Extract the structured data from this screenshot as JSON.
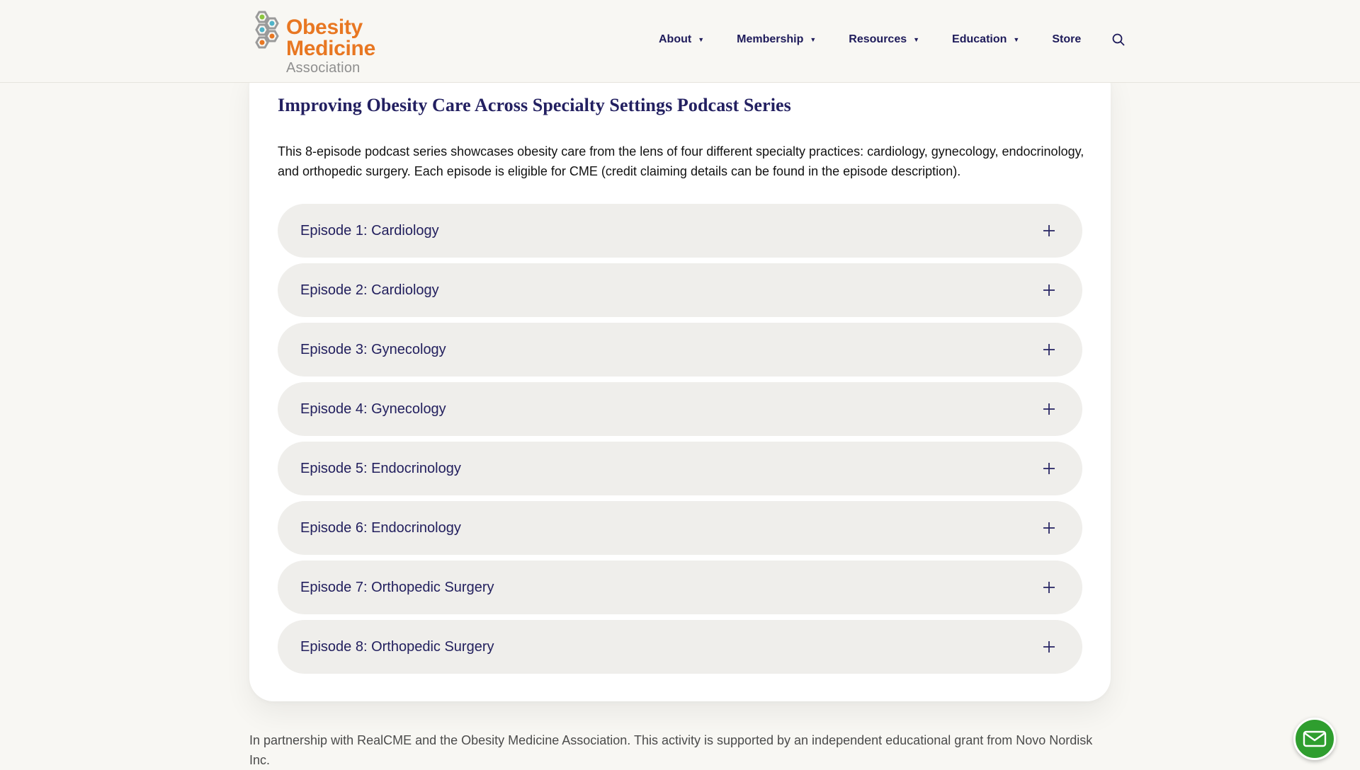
{
  "header": {
    "logo": {
      "line1": "Obesity",
      "line2": "Medicine",
      "line3": "Association",
      "colors": {
        "orange": "#e87722",
        "teal": "#4fb3c8",
        "green": "#8cc63f",
        "gray": "#8f8f8f"
      }
    },
    "nav": [
      {
        "label": "About",
        "has_dropdown": true
      },
      {
        "label": "Membership",
        "has_dropdown": true
      },
      {
        "label": "Resources",
        "has_dropdown": true
      },
      {
        "label": "Education",
        "has_dropdown": true
      },
      {
        "label": "Store",
        "has_dropdown": false
      }
    ],
    "caret_glyph": "▼",
    "search_icon": "search-icon"
  },
  "card": {
    "title": "Improving Obesity Care Across Specialty Settings Podcast Series",
    "description": "This 8-episode podcast series showcases obesity care from the lens of four different specialty practices: cardiology, gynecology, endocrinology, and orthopedic surgery. Each episode is eligible for CME (credit claiming details can be found in the episode description).",
    "episodes": [
      {
        "label": "Episode 1: Cardiology",
        "expanded": false
      },
      {
        "label": "Episode 2: Cardiology",
        "expanded": false
      },
      {
        "label": "Episode 3: Gynecology",
        "expanded": false
      },
      {
        "label": "Episode 4: Gynecology",
        "expanded": false
      },
      {
        "label": "Episode 5: Endocrinology",
        "expanded": false
      },
      {
        "label": "Episode 6: Endocrinology",
        "expanded": false
      },
      {
        "label": "Episode 7: Orthopedic Surgery",
        "expanded": false
      },
      {
        "label": "Episode 8: Orthopedic Surgery",
        "expanded": false
      }
    ],
    "expand_icon": "plus-icon"
  },
  "footer_note": "In partnership with RealCME and the Obesity Medicine Association. This activity is supported by an independent educational grant from Novo Nordisk Inc.",
  "contact_button": {
    "icon": "mail-icon",
    "color": "#2f9e2f"
  },
  "theme": {
    "navy": "#1e1b5a",
    "background": "#f8f7f3",
    "accordion_bg": "#efeeeb"
  }
}
